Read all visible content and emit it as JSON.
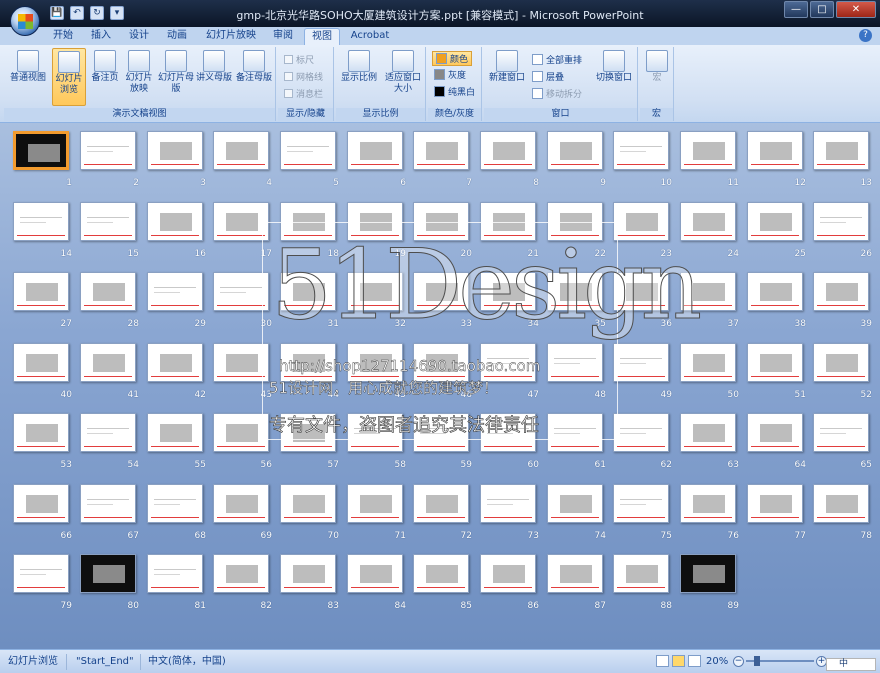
{
  "window": {
    "title": "gmp-北京光华路SOHO大厦建筑设计方案.ppt [兼容模式] - Microsoft PowerPoint",
    "controls": [
      "—",
      "□",
      "✕"
    ],
    "quick_access": [
      "💾",
      "↶",
      "↻",
      "▾"
    ]
  },
  "ribbon_tabs": [
    "开始",
    "插入",
    "设计",
    "动画",
    "幻灯片放映",
    "审阅",
    "视图",
    "Acrobat"
  ],
  "active_tab": "视图",
  "groups": {
    "presentation_views": {
      "label": "演示文稿视图",
      "buttons": [
        "普通视图",
        "幻灯片浏览",
        "备注页",
        "幻灯片放映",
        "幻灯片母版",
        "讲义母版",
        "备注母版"
      ]
    },
    "show_hide": {
      "label": "显示/隐藏",
      "items": [
        "标尺",
        "网格线",
        "消息栏"
      ]
    },
    "zoom": {
      "label": "显示比例",
      "buttons": [
        "显示比例",
        "适应窗口大小"
      ]
    },
    "color": {
      "label": "颜色/灰度",
      "items": [
        "颜色",
        "灰度",
        "纯黑白"
      ]
    },
    "window": {
      "label": "窗口",
      "new": "新建窗口",
      "items": [
        "全部重排",
        "层叠",
        "移动拆分"
      ],
      "switch": "切换窗口"
    },
    "macro": {
      "label": "宏",
      "button": "宏"
    }
  },
  "slides": [
    {
      "n": "1",
      "t": "dark"
    },
    {
      "n": "2",
      "t": "text"
    },
    {
      "n": "3",
      "t": "img"
    },
    {
      "n": "4",
      "t": "img"
    },
    {
      "n": "5",
      "t": "text"
    },
    {
      "n": "6",
      "t": "img"
    },
    {
      "n": "7",
      "t": "img"
    },
    {
      "n": "8",
      "t": "img"
    },
    {
      "n": "9",
      "t": "img"
    },
    {
      "n": "10",
      "t": "text"
    },
    {
      "n": "11",
      "t": "img"
    },
    {
      "n": "12",
      "t": "img"
    },
    {
      "n": "13",
      "t": "img"
    },
    {
      "n": "14",
      "t": "text"
    },
    {
      "n": "15",
      "t": "text"
    },
    {
      "n": "16",
      "t": "img"
    },
    {
      "n": "17",
      "t": "img"
    },
    {
      "n": "18",
      "t": "img"
    },
    {
      "n": "19",
      "t": "img"
    },
    {
      "n": "20",
      "t": "img"
    },
    {
      "n": "21",
      "t": "img"
    },
    {
      "n": "22",
      "t": "img"
    },
    {
      "n": "23",
      "t": "img"
    },
    {
      "n": "24",
      "t": "img"
    },
    {
      "n": "25",
      "t": "img"
    },
    {
      "n": "26",
      "t": "text"
    },
    {
      "n": "27",
      "t": "img"
    },
    {
      "n": "28",
      "t": "img"
    },
    {
      "n": "29",
      "t": "text"
    },
    {
      "n": "30",
      "t": "text"
    },
    {
      "n": "31",
      "t": "img"
    },
    {
      "n": "32",
      "t": "img"
    },
    {
      "n": "33",
      "t": "img"
    },
    {
      "n": "34",
      "t": "img"
    },
    {
      "n": "35",
      "t": "img"
    },
    {
      "n": "36",
      "t": "img"
    },
    {
      "n": "37",
      "t": "img"
    },
    {
      "n": "38",
      "t": "img"
    },
    {
      "n": "39",
      "t": "img"
    },
    {
      "n": "40",
      "t": "img"
    },
    {
      "n": "41",
      "t": "img"
    },
    {
      "n": "42",
      "t": "img"
    },
    {
      "n": "43",
      "t": "img"
    },
    {
      "n": "44",
      "t": "img"
    },
    {
      "n": "45",
      "t": "img"
    },
    {
      "n": "46",
      "t": "img"
    },
    {
      "n": "47",
      "t": "text"
    },
    {
      "n": "48",
      "t": "text"
    },
    {
      "n": "49",
      "t": "text"
    },
    {
      "n": "50",
      "t": "img"
    },
    {
      "n": "51",
      "t": "img"
    },
    {
      "n": "52",
      "t": "img"
    },
    {
      "n": "53",
      "t": "img"
    },
    {
      "n": "54",
      "t": "text"
    },
    {
      "n": "55",
      "t": "img"
    },
    {
      "n": "56",
      "t": "img"
    },
    {
      "n": "57",
      "t": "img"
    },
    {
      "n": "58",
      "t": "text"
    },
    {
      "n": "59",
      "t": "text"
    },
    {
      "n": "60",
      "t": "text"
    },
    {
      "n": "61",
      "t": "text"
    },
    {
      "n": "62",
      "t": "text"
    },
    {
      "n": "63",
      "t": "img"
    },
    {
      "n": "64",
      "t": "img"
    },
    {
      "n": "65",
      "t": "text"
    },
    {
      "n": "66",
      "t": "img"
    },
    {
      "n": "67",
      "t": "text"
    },
    {
      "n": "68",
      "t": "text"
    },
    {
      "n": "69",
      "t": "img"
    },
    {
      "n": "70",
      "t": "img"
    },
    {
      "n": "71",
      "t": "img"
    },
    {
      "n": "72",
      "t": "img"
    },
    {
      "n": "73",
      "t": "text"
    },
    {
      "n": "74",
      "t": "img"
    },
    {
      "n": "75",
      "t": "text"
    },
    {
      "n": "76",
      "t": "img"
    },
    {
      "n": "77",
      "t": "img"
    },
    {
      "n": "78",
      "t": "img"
    },
    {
      "n": "79",
      "t": "text"
    },
    {
      "n": "80",
      "t": "dark"
    },
    {
      "n": "81",
      "t": "text"
    },
    {
      "n": "82",
      "t": "img"
    },
    {
      "n": "83",
      "t": "img"
    },
    {
      "n": "84",
      "t": "img"
    },
    {
      "n": "85",
      "t": "img"
    },
    {
      "n": "86",
      "t": "img"
    },
    {
      "n": "87",
      "t": "img"
    },
    {
      "n": "88",
      "t": "img"
    },
    {
      "n": "89",
      "t": "dark"
    }
  ],
  "watermark": {
    "logo": "51Design",
    "url": "http://shop127114690.taobao.com",
    "slogan": "51设计网，用心成就您的建筑梦！",
    "warning": "专有文件，盗图者追究其法律责任"
  },
  "status": {
    "view": "幻灯片浏览",
    "theme": "\"Start_End\"",
    "language": "中文(简体，中国)",
    "zoom": "20%"
  },
  "ime": "中",
  "colors": {
    "selected_border": "#f29b2e",
    "accent_red": "#e23d3d",
    "ribbon": "#d2e0f3"
  }
}
